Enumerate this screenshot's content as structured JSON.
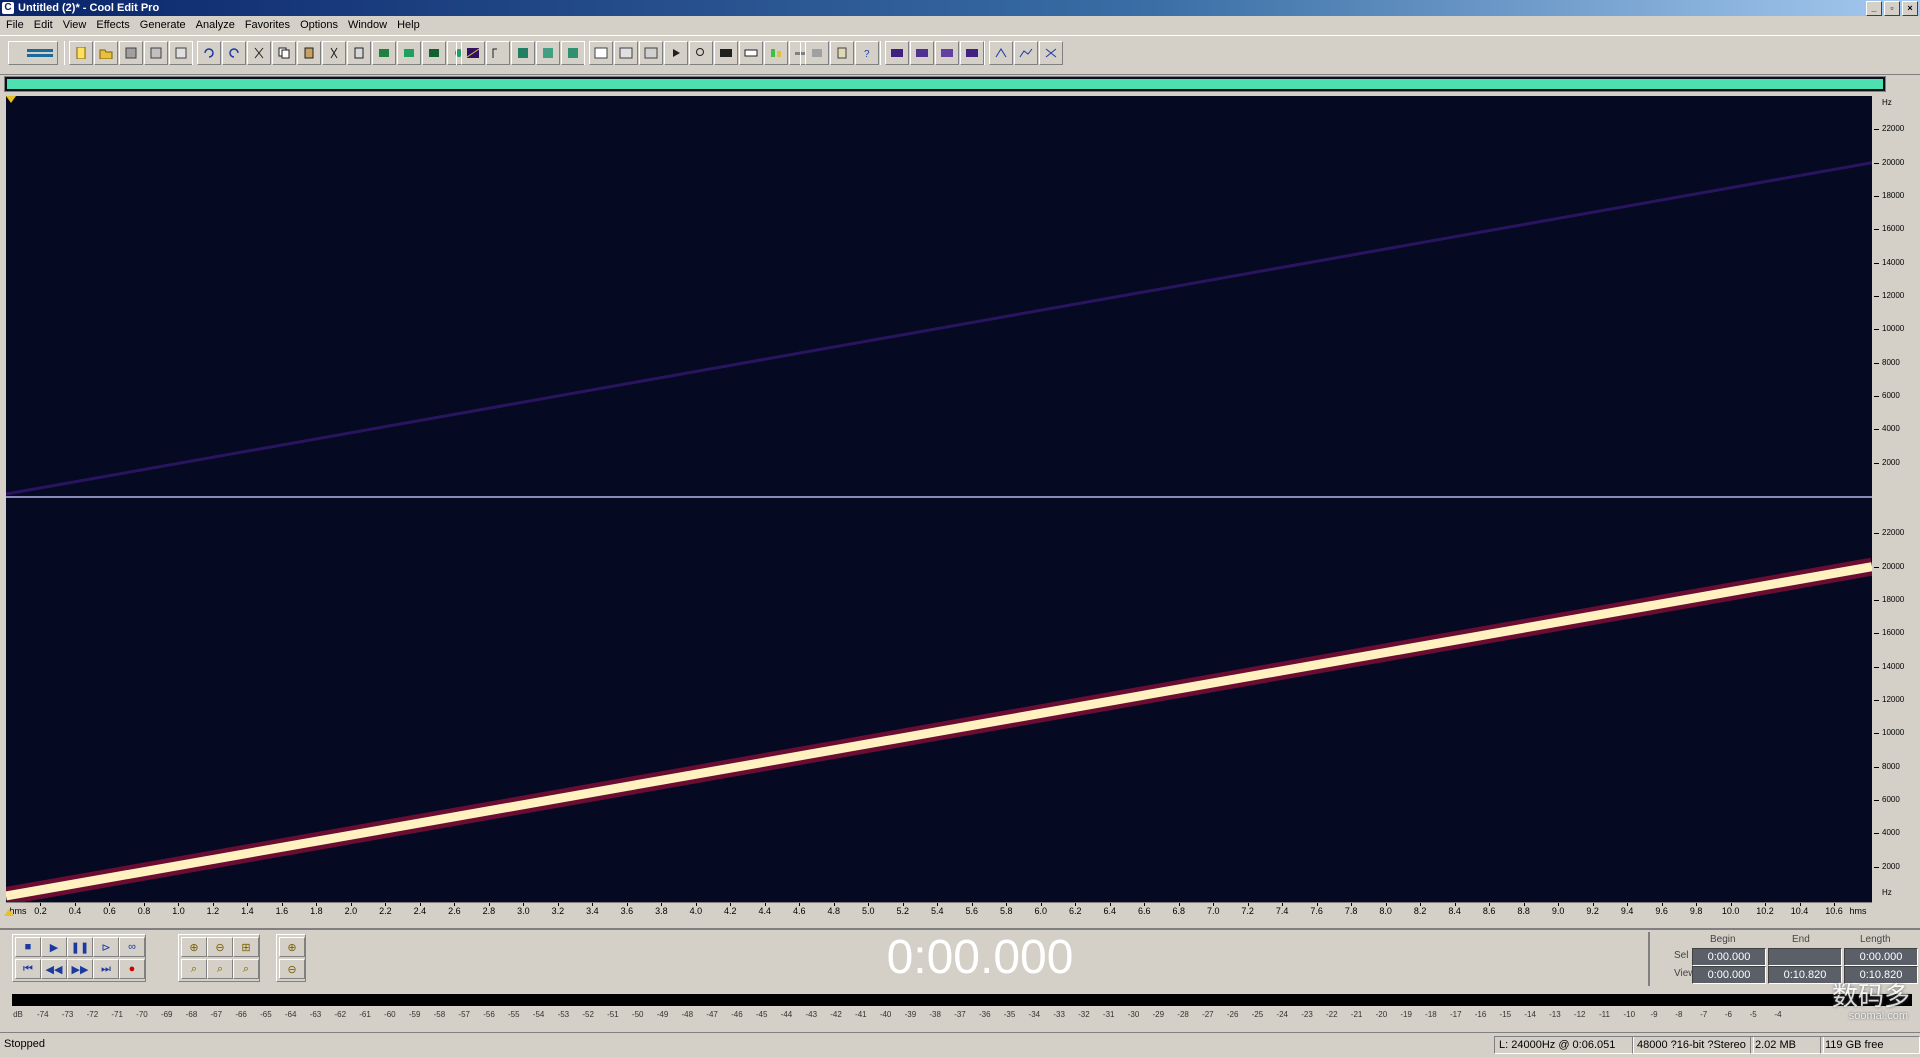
{
  "window": {
    "title": "Untitled (2)* - Cool Edit Pro",
    "controls": [
      "_",
      "▫",
      "×"
    ]
  },
  "menu": [
    "File",
    "Edit",
    "View",
    "Effects",
    "Generate",
    "Analyze",
    "Favorites",
    "Options",
    "Window",
    "Help"
  ],
  "spectral": {
    "freq_unit": "Hz",
    "freq_ticks": [
      "22000",
      "20000",
      "18000",
      "16000",
      "14000",
      "12000",
      "10000",
      "8000",
      "6000",
      "4000",
      "2000"
    ],
    "sweep_start_hz": 0,
    "sweep_end_hz": 20000,
    "sweep_color_top": "#2a1460",
    "sweep_color_bottom": "#fff2c0",
    "background": "#050a22"
  },
  "time_ruler": {
    "start_label": "hms",
    "end_label": "hms",
    "ticks": [
      "0.2",
      "0.4",
      "0.6",
      "0.8",
      "1.0",
      "1.2",
      "1.4",
      "1.6",
      "1.8",
      "2.0",
      "2.2",
      "2.4",
      "2.6",
      "2.8",
      "3.0",
      "3.2",
      "3.4",
      "3.6",
      "3.8",
      "4.0",
      "4.2",
      "4.4",
      "4.6",
      "4.8",
      "5.0",
      "5.2",
      "5.4",
      "5.6",
      "5.8",
      "6.0",
      "6.2",
      "6.4",
      "6.6",
      "6.8",
      "7.0",
      "7.2",
      "7.4",
      "7.6",
      "7.8",
      "8.0",
      "8.2",
      "8.4",
      "8.6",
      "8.8",
      "9.0",
      "9.2",
      "9.4",
      "9.6",
      "9.8",
      "10.0",
      "10.2",
      "10.4",
      "10.6"
    ]
  },
  "transport": {
    "time": "0:00.000",
    "headers": {
      "begin": "Begin",
      "end": "End",
      "length": "Length"
    },
    "sel": {
      "label": "Sel",
      "begin": "0:00.000",
      "end": "",
      "length": "0:00.000"
    },
    "view": {
      "label": "View",
      "begin": "0:00.000",
      "end": "0:10.820",
      "length": "0:10.820"
    }
  },
  "meter": {
    "scale": [
      "dB",
      "-74",
      "-73",
      "-72",
      "-71",
      "-70",
      "-69",
      "-68",
      "-67",
      "-66",
      "-65",
      "-64",
      "-63",
      "-62",
      "-61",
      "-60",
      "-59",
      "-58",
      "-57",
      "-56",
      "-55",
      "-54",
      "-53",
      "-52",
      "-51",
      "-50",
      "-49",
      "-48",
      "-47",
      "-46",
      "-45",
      "-44",
      "-43",
      "-42",
      "-41",
      "-40",
      "-39",
      "-38",
      "-37",
      "-36",
      "-35",
      "-34",
      "-33",
      "-32",
      "-31",
      "-30",
      "-29",
      "-28",
      "-27",
      "-26",
      "-25",
      "-24",
      "-23",
      "-22",
      "-21",
      "-20",
      "-19",
      "-18",
      "-17",
      "-16",
      "-15",
      "-14",
      "-13",
      "-12",
      "-11",
      "-10",
      "-9",
      "-8",
      "-7",
      "-6",
      "-5",
      "-4"
    ]
  },
  "status": {
    "state": "Stopped",
    "freq_info": "L: 24000Hz @   0:06.051",
    "format": "48000 ?16-bit ?Stereo",
    "size": "2.02 MB",
    "free": "119 GB free"
  },
  "watermark": {
    "main": "数码多",
    "sub": "soomal.com"
  }
}
